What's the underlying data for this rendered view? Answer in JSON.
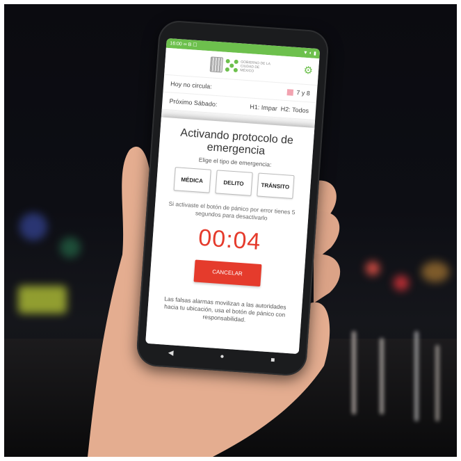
{
  "status_bar": {
    "time": "16:00",
    "left_icons": "∞ B ☐",
    "right_icons": "▼ ◐ ▮"
  },
  "header": {
    "gov_text": "GOBIERNO DE LA CIUDAD DE MÉXICO",
    "settings_icon": "gear-icon"
  },
  "info": {
    "hoy_no_circula_label": "Hoy no circula:",
    "hoy_no_circula_value": "7 y 8",
    "proximo_sabado_label": "Próximo Sábado:",
    "h1": "H1: Impar",
    "h2": "H2: Todos"
  },
  "dialog": {
    "title": "Activando protocolo de emergencia",
    "subtitle": "Elige el tipo de emergencia:",
    "types": [
      "MÉDICA",
      "DELITO",
      "TRÁNSITO"
    ],
    "message": "Si activaste el botón de pánico por error tienes 5 segundos para desactivarlo",
    "countdown": "00:04",
    "cancel_label": "CANCELAR",
    "warning": "Las falsas alarmas movilizan a las autoridades hacia tu ubicación, usa el botón de pánico con responsabilidad."
  },
  "nav": {
    "back": "◀",
    "home": "●",
    "recents": "■"
  },
  "colors": {
    "accent_green": "#6dc04d",
    "alert_red": "#e53b2c"
  }
}
